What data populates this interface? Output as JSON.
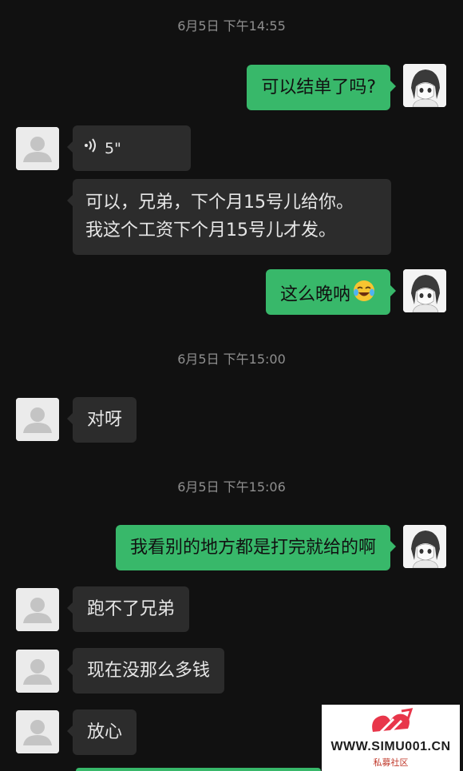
{
  "chat": {
    "timestamps": [
      "6月5日 下午14:55",
      "6月5日 下午15:00",
      "6月5日 下午15:06"
    ],
    "messages": {
      "m1": "可以结单了吗?",
      "m2_voice_duration": "5\"",
      "m3_line1": "可以，兄弟，下个月15号儿给你。",
      "m3_line2": "我这个工资下个月15号儿才发。",
      "m4": "这么晚呐",
      "m5": "对呀",
      "m6": "我看别的地方都是打完就给的啊",
      "m7": "跑不了兄弟",
      "m8": "现在没那么多钱",
      "m9": "放心"
    },
    "icons": {
      "voice": "voice-wave-icon",
      "emoji": "laughing-crying-emoji-icon",
      "avatar_other": "default-avatar-icon",
      "avatar_me": "anime-avatar-icon"
    },
    "colors": {
      "background": "#111111",
      "outgoing_bubble": "#38b86a",
      "incoming_bubble": "#2c2c2c"
    }
  },
  "watermark": {
    "text": "WWW.SIMU001.CN",
    "subtext": "私募社区"
  }
}
